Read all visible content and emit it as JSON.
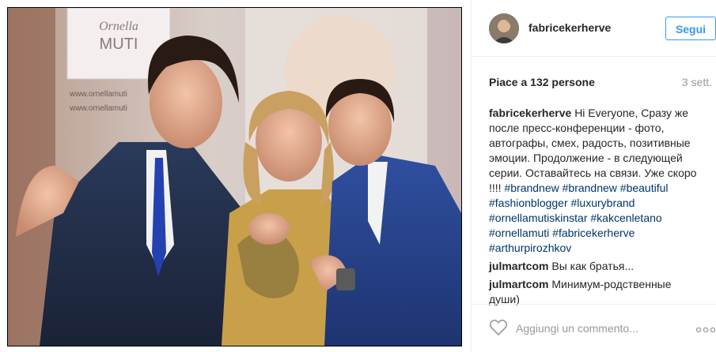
{
  "post": {
    "username": "fabricekerherve",
    "follow_label": "Segui",
    "likes": "Piace a 132 persone",
    "time": "3 sett.",
    "photo_banner": {
      "brand_line1": "Ornella",
      "brand_line2": "MUTI",
      "url1": "www.ornellamuti",
      "url2": "www.ornellamuti"
    },
    "caption": {
      "author": "fabricekerherve",
      "text": "Hi Everyone, Сразу же после пресс-конференции - фото, автографы, смех, радость, позитивные эмоции. Продолжение - в следующей серии. Оставайтесь на связи. Уже скоро !!!! ",
      "tags": "#brandnew #brandnew #beautiful #fashionblogger #luxurybrand #ornellamutiskinstar #kakcenletano #ornellamuti #fabricekerherve #arthurpirozhkov"
    },
    "comments": [
      {
        "author": "julmartcom",
        "text": "Вы как братья..."
      },
      {
        "author": "julmartcom",
        "text": "Минимум-родственные души)"
      }
    ],
    "add_comment_placeholder": "Aggiungi un commento...",
    "icons": {
      "like": "heart-icon",
      "more": "more-options-icon"
    }
  }
}
